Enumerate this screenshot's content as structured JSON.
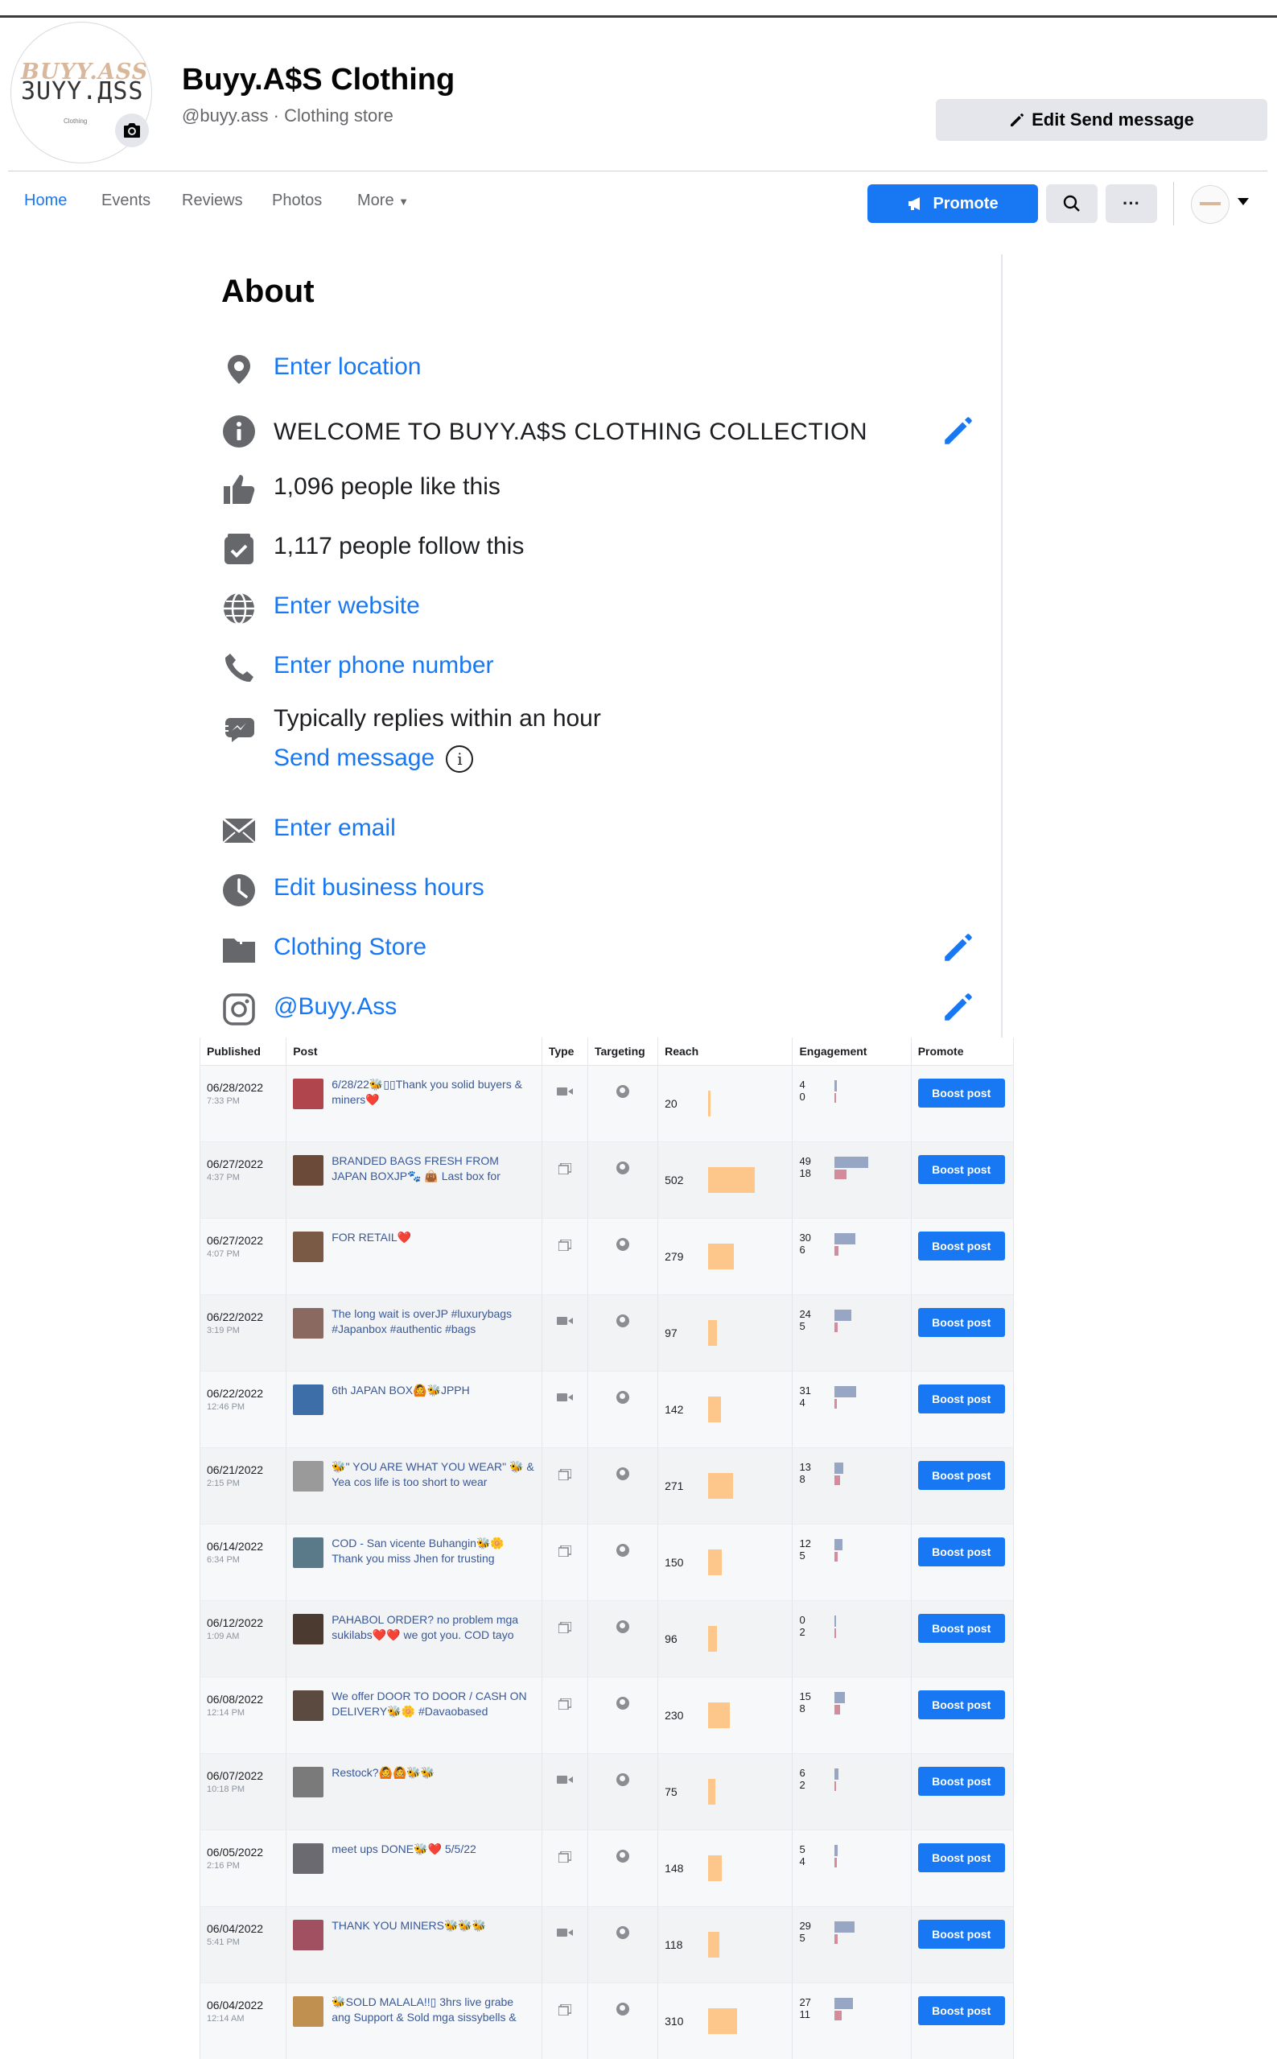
{
  "header": {
    "page_name": "Buyy.A$S Clothing",
    "page_sub": "@buyy.ass · Clothing store",
    "logo_line1": "BUYY.ASS",
    "logo_line2": "ЗUYY.ДSS",
    "logo_line3": "Clothing",
    "edit_send_message": "Edit Send message"
  },
  "nav": {
    "tabs": [
      "Home",
      "Events",
      "Reviews",
      "Photos",
      "More"
    ],
    "promote": "Promote"
  },
  "about": {
    "title": "About",
    "location": "Enter location",
    "intro": "WELCOME TO BUYY.A$S CLOTHING COLLECTION",
    "likes": "1,096 people like this",
    "follows": "1,117 people follow this",
    "website": "Enter website",
    "phone": "Enter phone number",
    "replies": "Typically replies within an hour",
    "send_message": "Send message",
    "email": "Enter email",
    "hours": "Edit business hours",
    "category": "Clothing Store",
    "instagram": "@Buyy.Ass"
  },
  "table": {
    "headers": [
      "Published",
      "Post",
      "Type",
      "Targeting",
      "Reach",
      "Engagement",
      "Promote"
    ],
    "boost_label": "Boost post",
    "rows": [
      {
        "date": "06/28/2022",
        "time": "7:33 PM",
        "post": "6/28/22🐝▯▯Thank you solid buyers & miners❤️",
        "type": "video",
        "reach": 20,
        "eng1": 4,
        "eng2": 0,
        "thumb": "#b0454e"
      },
      {
        "date": "06/27/2022",
        "time": "4:37 PM",
        "post": "BRANDED BAGS FRESH FROM JAPAN BOXJP🐾 👜 Last box for",
        "type": "album",
        "reach": 502,
        "eng1": 49,
        "eng2": 18,
        "thumb": "#6b4a3a"
      },
      {
        "date": "06/27/2022",
        "time": "4:07 PM",
        "post": "FOR RETAIL❤️",
        "type": "album",
        "reach": 279,
        "eng1": 30,
        "eng2": 6,
        "thumb": "#7a5a44"
      },
      {
        "date": "06/22/2022",
        "time": "3:19 PM",
        "post": "The long wait is overJP #luxurybags #Japanbox #authentic #bags",
        "type": "video",
        "reach": 97,
        "eng1": 24,
        "eng2": 5,
        "thumb": "#8a6a60"
      },
      {
        "date": "06/22/2022",
        "time": "12:46 PM",
        "post": "6th JAPAN BOX🙆🐝JPPH",
        "type": "video",
        "reach": 142,
        "eng1": 31,
        "eng2": 4,
        "thumb": "#3d6ea8"
      },
      {
        "date": "06/21/2022",
        "time": "2:15 PM",
        "post": "🐝\" YOU ARE WHAT YOU WEAR\" 🐝 & Yea cos life is too short to wear",
        "type": "album",
        "reach": 271,
        "eng1": 13,
        "eng2": 8,
        "thumb": "#9a9a9a"
      },
      {
        "date": "06/14/2022",
        "time": "6:34 PM",
        "post": "COD - San vicente Buhangin🐝🌼 Thank you miss Jhen for trusting",
        "type": "album",
        "reach": 150,
        "eng1": 12,
        "eng2": 5,
        "thumb": "#5a7a8a"
      },
      {
        "date": "06/12/2022",
        "time": "1:09 AM",
        "post": "PAHABOL ORDER? no problem mga sukilabs❤️❤️ we got you. COD tayo",
        "type": "album",
        "reach": 96,
        "eng1": 0,
        "eng2": 2,
        "thumb": "#4a3a30"
      },
      {
        "date": "06/08/2022",
        "time": "12:14 PM",
        "post": "We offer DOOR TO DOOR / CASH ON DELIVERY🐝🌼 #Davaobased",
        "type": "album",
        "reach": 230,
        "eng1": 15,
        "eng2": 8,
        "thumb": "#5a4a40"
      },
      {
        "date": "06/07/2022",
        "time": "10:18 PM",
        "post": "Restock?🙆🙆🐝🐝",
        "type": "video",
        "reach": 75,
        "eng1": 6,
        "eng2": 2,
        "thumb": "#7a7a7a"
      },
      {
        "date": "06/05/2022",
        "time": "2:16 PM",
        "post": "meet ups DONE🐝❤️ 5/5/22",
        "type": "album",
        "reach": 148,
        "eng1": 5,
        "eng2": 4,
        "thumb": "#6a6a70"
      },
      {
        "date": "06/04/2022",
        "time": "5:41 PM",
        "post": "THANK YOU MINERS🐝🐝🐝",
        "type": "video",
        "reach": 118,
        "eng1": 29,
        "eng2": 5,
        "thumb": "#a05060"
      },
      {
        "date": "06/04/2022",
        "time": "12:14 AM",
        "post": "🐝SOLD MALALA!!▯ 3hrs live grabe ang Support & Sold mga sissybells &",
        "type": "album",
        "reach": 310,
        "eng1": 27,
        "eng2": 11,
        "thumb": "#c09050"
      }
    ]
  }
}
